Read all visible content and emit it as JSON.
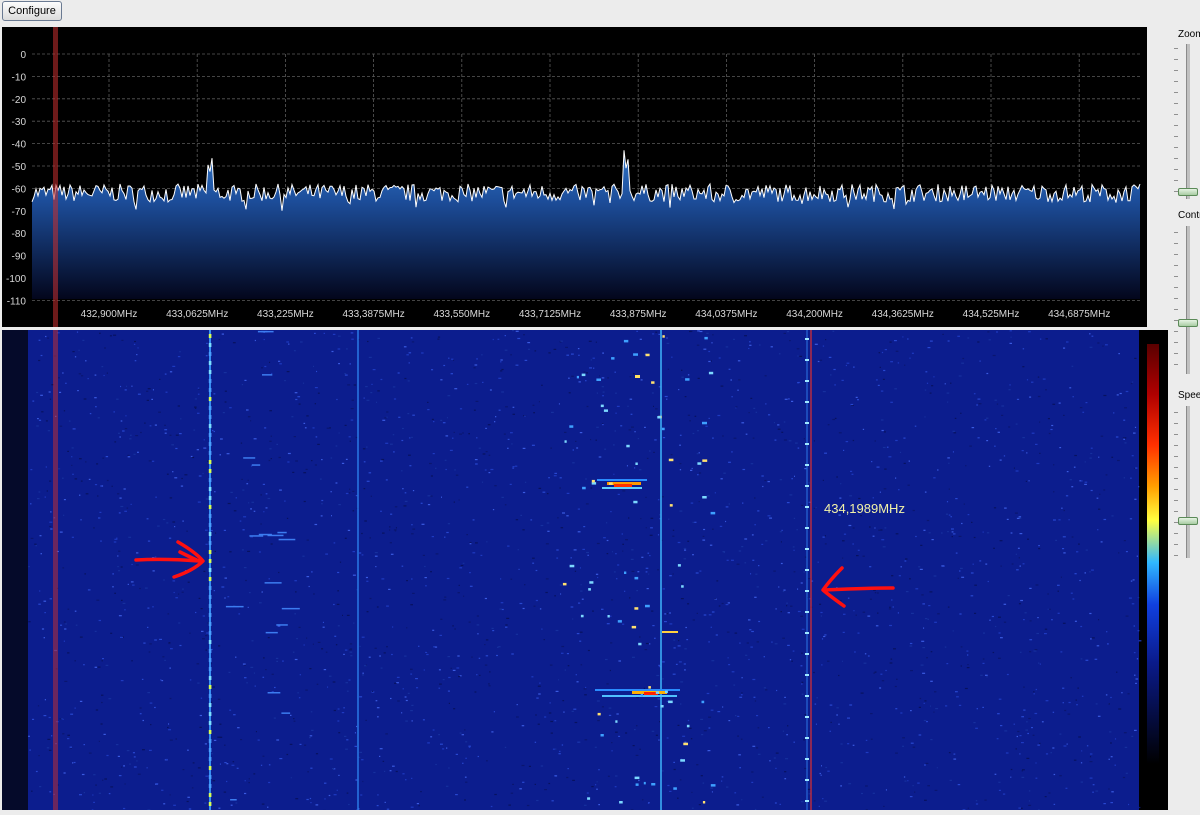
{
  "toolbar": {
    "configure_label": "Configure"
  },
  "spectrum": {
    "y_ticks": [
      "0",
      "-10",
      "-20",
      "-30",
      "-40",
      "-50",
      "-60",
      "-70",
      "-80",
      "-90",
      "-100",
      "-110"
    ],
    "x_ticks": [
      "432,900MHz",
      "433,0625MHz",
      "433,225MHz",
      "433,3875MHz",
      "433,550MHz",
      "433,7125MHz",
      "433,875MHz",
      "434,0375MHz",
      "434,200MHz",
      "434,3625MHz",
      "434,525MHz",
      "434,6875MHz"
    ],
    "colors": {
      "background": "#000000",
      "fill_top": "#2b6fc4",
      "fill_bottom": "#050a25",
      "trace": "#ffffff",
      "grid": "#5a5a5a",
      "marker": "#c83030"
    }
  },
  "waterfall": {
    "frequency_readout": "434,1989MHz",
    "colors": {
      "background": "#0a1a8a",
      "marker": "#e03030",
      "annotation_arrow": "#ff0000"
    }
  },
  "sidebar": {
    "zoom_label": "Zoom",
    "contrast_label": "Contrast",
    "speed_label": "Speed"
  }
}
